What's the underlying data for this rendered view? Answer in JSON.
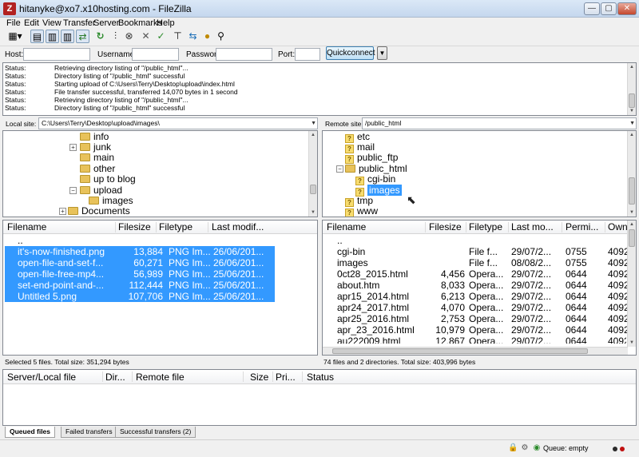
{
  "window": {
    "title": "hitanyke@xo7.x10hosting.com - FileZilla",
    "min": "—",
    "max": "▢",
    "close": "✕"
  },
  "menu": [
    "File",
    "Edit",
    "View",
    "Transfer",
    "Server",
    "Bookmarks",
    "Help"
  ],
  "quickconnect": {
    "host_label": "Host:",
    "username_label": "Username:",
    "password_label": "Password:",
    "port_label": "Port:",
    "button": "Quickconnect",
    "dropdown": "▼"
  },
  "log": [
    {
      "k": "Status:",
      "v": "Retrieving directory listing of \"/public_html\"..."
    },
    {
      "k": "Status:",
      "v": "Directory listing of \"/public_html\" successful"
    },
    {
      "k": "Status:",
      "v": "Starting upload of C:\\Users\\Terry\\Desktop\\upload\\index.html"
    },
    {
      "k": "Status:",
      "v": "File transfer successful, transferred 14,070 bytes in 1 second"
    },
    {
      "k": "Status:",
      "v": "Retrieving directory listing of \"/public_html\"..."
    },
    {
      "k": "Status:",
      "v": "Directory listing of \"/public_html\" successful"
    }
  ],
  "local": {
    "site_label": "Local site:",
    "path": "C:\\Users\\Terry\\Desktop\\upload\\images\\",
    "tree": [
      "info",
      "junk",
      "main",
      "other",
      "up to blog",
      "upload",
      "images",
      "Documents"
    ],
    "columns": [
      "Filename",
      "Filesize",
      "Filetype",
      "Last modif..."
    ],
    "parent": "..",
    "files": [
      {
        "name": "it's-now-finished.png",
        "size": "13,884",
        "type": "PNG Im...",
        "date": "26/06/201..."
      },
      {
        "name": "open-file-and-set-f...",
        "size": "60,271",
        "type": "PNG Im...",
        "date": "26/06/201..."
      },
      {
        "name": "open-file-free-mp4...",
        "size": "56,989",
        "type": "PNG Im...",
        "date": "25/06/201..."
      },
      {
        "name": "set-end-point-and-...",
        "size": "112,444",
        "type": "PNG Im...",
        "date": "25/06/201..."
      },
      {
        "name": "Untitled 5.png",
        "size": "107,706",
        "type": "PNG Im...",
        "date": "25/06/201..."
      }
    ],
    "status": "Selected 5 files. Total size: 351,294 bytes"
  },
  "remote": {
    "site_label": "Remote site:",
    "path": "/public_html",
    "tree": [
      "etc",
      "mail",
      "public_ftp",
      "public_html",
      "cgi-bin",
      "images",
      "tmp",
      "www"
    ],
    "columns": [
      "Filename",
      "Filesize",
      "Filetype",
      "Last mo...",
      "Permi...",
      "Own"
    ],
    "parent": "..",
    "files": [
      {
        "name": "cgi-bin",
        "size": "",
        "type": "File f...",
        "date": "29/07/2...",
        "perm": "0755",
        "owner": "4092"
      },
      {
        "name": "images",
        "size": "",
        "type": "File f...",
        "date": "08/08/2...",
        "perm": "0755",
        "owner": "4092"
      },
      {
        "name": "0ct28_2015.html",
        "size": "4,456",
        "type": "Opera...",
        "date": "29/07/2...",
        "perm": "0644",
        "owner": "4092"
      },
      {
        "name": "about.htm",
        "size": "8,033",
        "type": "Opera...",
        "date": "29/07/2...",
        "perm": "0644",
        "owner": "4092"
      },
      {
        "name": "apr15_2014.html",
        "size": "6,213",
        "type": "Opera...",
        "date": "29/07/2...",
        "perm": "0644",
        "owner": "4092"
      },
      {
        "name": "apr24_2017.html",
        "size": "4,070",
        "type": "Opera...",
        "date": "29/07/2...",
        "perm": "0644",
        "owner": "4092"
      },
      {
        "name": "apr25_2016.html",
        "size": "2,753",
        "type": "Opera...",
        "date": "29/07/2...",
        "perm": "0644",
        "owner": "4092"
      },
      {
        "name": "apr_23_2016.html",
        "size": "10,979",
        "type": "Opera...",
        "date": "29/07/2...",
        "perm": "0644",
        "owner": "4092"
      },
      {
        "name": "au222009.html",
        "size": "12,867",
        "type": "Opera...",
        "date": "29/07/2...",
        "perm": "0644",
        "owner": "4092"
      }
    ],
    "status": "74 files and 2 directories. Total size: 403,996 bytes"
  },
  "queue": {
    "columns": [
      "Server/Local file",
      "Dir...",
      "Remote file",
      "Size",
      "Pri...",
      "Status"
    ],
    "tabs": [
      "Queued files",
      "Failed transfers",
      "Successful transfers (2)"
    ]
  },
  "statusbar": {
    "queue": "Queue: empty"
  },
  "colors": {
    "selection": "#3399ff",
    "opera_icon": "#d01818",
    "folder": "#e8c25a"
  }
}
